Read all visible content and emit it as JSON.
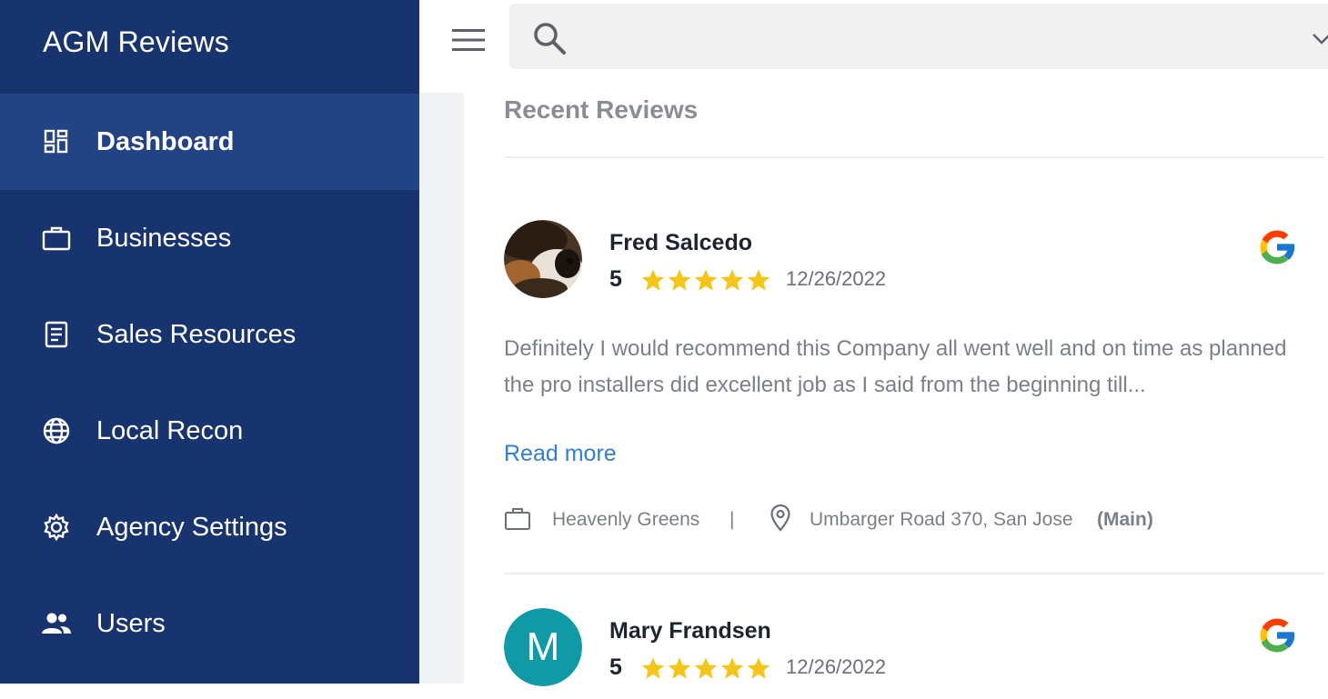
{
  "app": {
    "title": "AGM Reviews"
  },
  "sidebar": {
    "items": [
      {
        "label": "Dashboard",
        "icon": "dashboard-icon",
        "active": true
      },
      {
        "label": "Businesses",
        "icon": "briefcase-icon",
        "active": false
      },
      {
        "label": "Sales Resources",
        "icon": "document-icon",
        "active": false
      },
      {
        "label": "Local Recon",
        "icon": "globe-icon",
        "active": false
      },
      {
        "label": "Agency Settings",
        "icon": "gear-icon",
        "active": false
      },
      {
        "label": "Users",
        "icon": "users-icon",
        "active": false
      }
    ]
  },
  "topbar": {
    "search_value": ""
  },
  "main": {
    "section_title": "Recent Reviews",
    "reviews": [
      {
        "name": "Fred Salcedo",
        "rating": "5",
        "stars": 5,
        "date": "12/26/2022",
        "source": "google-icon",
        "text": "Definitely I would recommend this Company all went well and on time as planned the pro installers did excellent job as I said from the beginning till...",
        "read_more": "Read more",
        "business": "Heavenly Greens",
        "separator": "|",
        "address": "Umbarger Road 370, San Jose",
        "location_tag": "(Main)"
      },
      {
        "name": "Mary Frandsen",
        "avatar_letter": "M",
        "rating": "5",
        "stars": 5,
        "date": "12/26/2022",
        "source": "google-icon"
      }
    ]
  },
  "colors": {
    "sidebar_bg": "#18346e",
    "sidebar_active": "#224384",
    "star": "#f5c518",
    "link": "#2f7ed8",
    "avatar_teal": "#0f9aa6"
  }
}
